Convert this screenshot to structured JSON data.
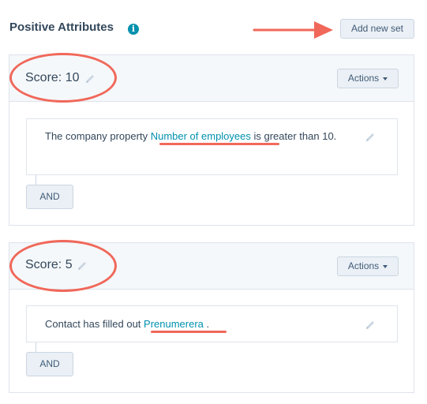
{
  "header": {
    "title": "Positive Attributes",
    "info_icon": "info-icon",
    "add_button_label": "Add new set"
  },
  "sets": [
    {
      "score_label": "Score: 10",
      "actions_label": "Actions",
      "rule": {
        "prefix": "The company property",
        "link": "Number of employees",
        "suffix": "is greater than 10."
      },
      "and_label": "AND"
    },
    {
      "score_label": "Score: 5",
      "actions_label": "Actions",
      "rule": {
        "prefix": "Contact has filled out",
        "link": "Prenumerera",
        "suffix": "."
      },
      "and_label": "AND"
    }
  ],
  "colors": {
    "annotation": "#f0685a",
    "link": "#0091ae",
    "text": "#33475b",
    "panel_bg": "#f5f8fa",
    "button_bg": "#eaf0f6"
  }
}
